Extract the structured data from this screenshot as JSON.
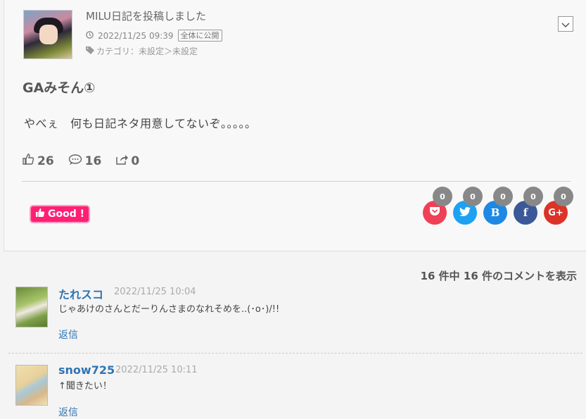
{
  "post": {
    "title": "MILU日記を投稿しました",
    "date": "2022/11/25 09:39",
    "visibility": "全体に公開",
    "category": "カテゴリ：未設定＞未設定",
    "heading": "GAみそん①",
    "body": "やべぇ　何も日記ネタ用意してないぞ。。。。。",
    "stats": {
      "likes": "26",
      "comments": "16",
      "shares": "0"
    },
    "good_label": "Good !"
  },
  "share": [
    {
      "name": "pocket",
      "count": "0",
      "color": "#ef4056"
    },
    {
      "name": "twitter",
      "count": "0",
      "color": "#1da1f2"
    },
    {
      "name": "hatena",
      "count": "0",
      "color": "#1e88e5"
    },
    {
      "name": "facebook",
      "count": "0",
      "color": "#3b5998"
    },
    {
      "name": "google-plus",
      "count": "0",
      "color": "#db3328"
    }
  ],
  "comments_header": "16 件中 16 件のコメントを表示",
  "comments": [
    {
      "name": "たれスコ",
      "date": "2022/11/25 10:04",
      "text": "じゃあけのさんとだーりんさまのなれそめを..(･o･)/!!",
      "reply": "返信"
    },
    {
      "name": "snow725",
      "date": "2022/11/25 10:11",
      "text": "↑聞きたい！",
      "reply": "返信"
    }
  ]
}
